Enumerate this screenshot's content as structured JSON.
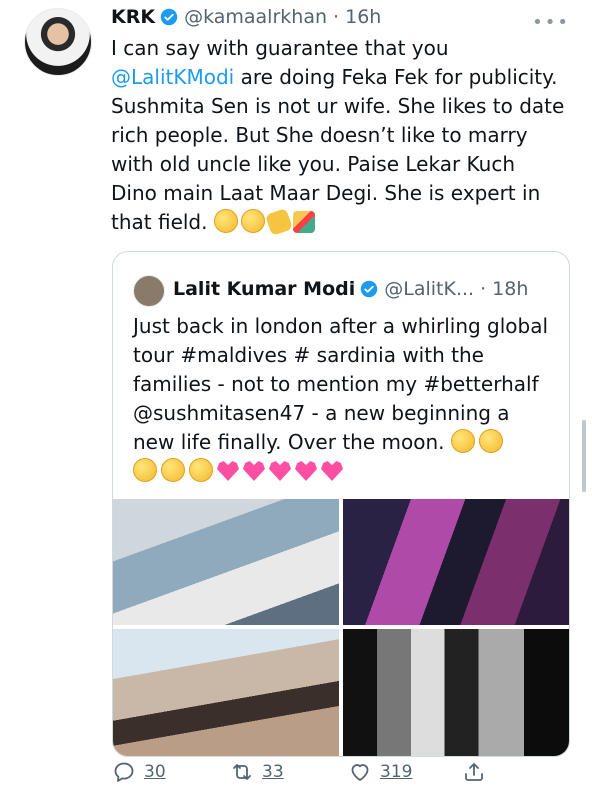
{
  "tweet": {
    "author_name": "KRK",
    "author_handle": "@kamaalrkhan · 16h",
    "more_label": "•••",
    "text_parts": {
      "p1": "I can say with guarantee that you ",
      "mention": "@LalitKModi",
      "p2": " are doing Feka Fek for publicity. Sushmita Sen is not ur wife. She likes to date rich people. But She doesn’t like to marry with old uncle like you. Paise Lekar Kuch Dino main Laat Maar Degi. She is expert in that field. "
    },
    "emojis": [
      "zany-face-emoji",
      "grinning-face-emoji",
      "clapping-hands-emoji",
      "party-popper-emoji"
    ]
  },
  "quoted": {
    "author_name": "Lalit Kumar Modi",
    "author_handle": "@LalitK... · 18h",
    "text": "Just back in london after a whirling global tour #maldives # sardinia with the families - not to mention my #betterhalf @sushmitasen47 - a new beginning a new life finally. Over the moon. ",
    "emojis": [
      "smiling-face-with-hearts-emoji",
      "face-blowing-kiss-emoji",
      "heart-eyes-emoji",
      "heart-eyes-emoji",
      "smiling-face-with-hearts-emoji",
      "revolving-hearts-emoji",
      "heart-with-ribbon-emoji",
      "sparkling-heart-emoji",
      "broken-hearts-emoji",
      "growing-heart-emoji"
    ],
    "photos": [
      "hospital-photo",
      "event-photo",
      "selfie-photo",
      "black-white-photo"
    ]
  },
  "actions": {
    "reply_count": "30",
    "retweet_count": "33",
    "like_count": "319"
  },
  "colors": {
    "link": "#1d9bf0",
    "secondary_text": "#536471",
    "verified": "#1d9bf0"
  }
}
